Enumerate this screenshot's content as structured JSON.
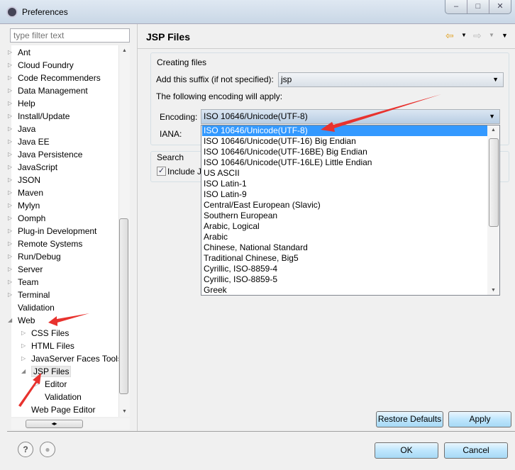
{
  "window": {
    "title": "Preferences",
    "buttons": [
      "–",
      "□",
      "✕"
    ]
  },
  "sidebar": {
    "filter_placeholder": "type filter text",
    "items": [
      {
        "label": "Ant",
        "level": 0,
        "twisty": "collapsed"
      },
      {
        "label": "Cloud Foundry",
        "level": 0,
        "twisty": "collapsed"
      },
      {
        "label": "Code Recommenders",
        "level": 0,
        "twisty": "collapsed"
      },
      {
        "label": "Data Management",
        "level": 0,
        "twisty": "collapsed"
      },
      {
        "label": "Help",
        "level": 0,
        "twisty": "collapsed"
      },
      {
        "label": "Install/Update",
        "level": 0,
        "twisty": "collapsed"
      },
      {
        "label": "Java",
        "level": 0,
        "twisty": "collapsed"
      },
      {
        "label": "Java EE",
        "level": 0,
        "twisty": "collapsed"
      },
      {
        "label": "Java Persistence",
        "level": 0,
        "twisty": "collapsed"
      },
      {
        "label": "JavaScript",
        "level": 0,
        "twisty": "collapsed"
      },
      {
        "label": "JSON",
        "level": 0,
        "twisty": "collapsed"
      },
      {
        "label": "Maven",
        "level": 0,
        "twisty": "collapsed"
      },
      {
        "label": "Mylyn",
        "level": 0,
        "twisty": "collapsed"
      },
      {
        "label": "Oomph",
        "level": 0,
        "twisty": "collapsed"
      },
      {
        "label": "Plug-in Development",
        "level": 0,
        "twisty": "collapsed"
      },
      {
        "label": "Remote Systems",
        "level": 0,
        "twisty": "collapsed"
      },
      {
        "label": "Run/Debug",
        "level": 0,
        "twisty": "collapsed"
      },
      {
        "label": "Server",
        "level": 0,
        "twisty": "collapsed"
      },
      {
        "label": "Team",
        "level": 0,
        "twisty": "collapsed"
      },
      {
        "label": "Terminal",
        "level": 0,
        "twisty": "collapsed"
      },
      {
        "label": "Validation",
        "level": 0,
        "twisty": "none"
      },
      {
        "label": "Web",
        "level": 0,
        "twisty": "expanded"
      },
      {
        "label": "CSS Files",
        "level": 1,
        "twisty": "collapsed"
      },
      {
        "label": "HTML Files",
        "level": 1,
        "twisty": "collapsed"
      },
      {
        "label": "JavaServer Faces Tools",
        "level": 1,
        "twisty": "collapsed"
      },
      {
        "label": "JSP Files",
        "level": 1,
        "twisty": "expanded",
        "selected": true
      },
      {
        "label": "Editor",
        "level": 2,
        "twisty": "collapsed"
      },
      {
        "label": "Validation",
        "level": 2,
        "twisty": "none"
      },
      {
        "label": "Web Page Editor",
        "level": 1,
        "twisty": "none"
      }
    ]
  },
  "page": {
    "title": "JSP Files",
    "creating_group": "Creating files",
    "suffix_label": "Add this suffix (if not specified):",
    "suffix_value": "jsp",
    "encoding_note": "The following encoding will apply:",
    "encoding_label": "Encoding:",
    "encoding_value": "ISO 10646/Unicode(UTF-8)",
    "iana_label": "IANA:",
    "search_group": "Search",
    "include_label": "Include J",
    "include_checked": true,
    "encoding_options": [
      "ISO 10646/Unicode(UTF-8)",
      "ISO 10646/Unicode(UTF-16) Big Endian",
      "ISO 10646/Unicode(UTF-16BE) Big Endian",
      "ISO 10646/Unicode(UTF-16LE) Little Endian",
      "US ASCII",
      "ISO Latin-1",
      "ISO Latin-9",
      "Central/East European (Slavic)",
      "Southern European",
      "Arabic, Logical",
      "Arabic",
      "Chinese, National Standard",
      "Traditional Chinese, Big5",
      "Cyrillic, ISO-8859-4",
      "Cyrillic, ISO-8859-5",
      "Greek"
    ],
    "restore_defaults": "Restore Defaults",
    "apply": "Apply"
  },
  "footer": {
    "ok": "OK",
    "cancel": "Cancel",
    "help_glyph": "?"
  },
  "colors": {
    "selection": "#3399ff",
    "annotation_arrow": "#e8322e"
  }
}
